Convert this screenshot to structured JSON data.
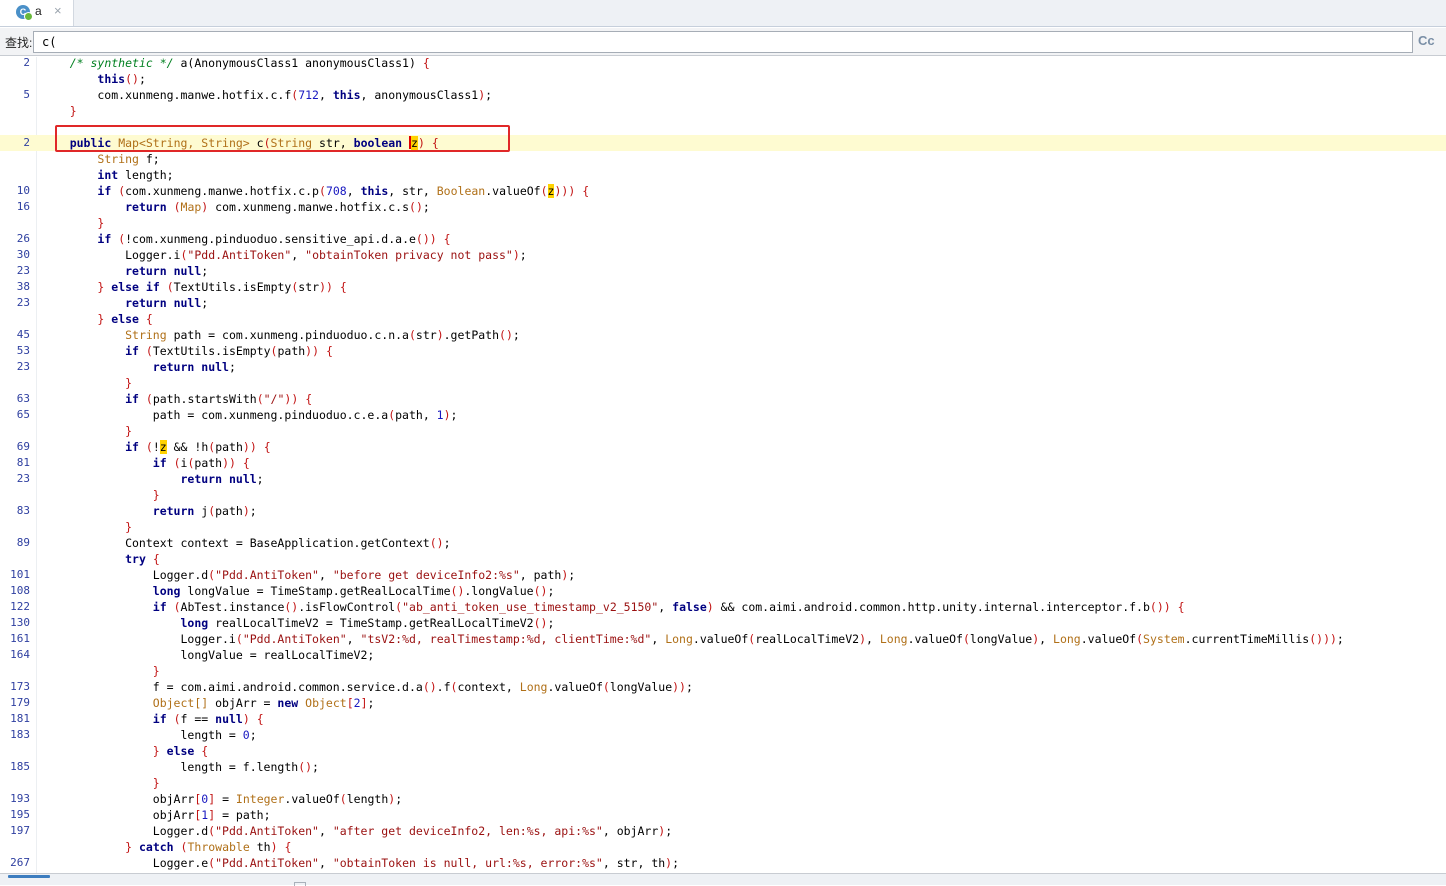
{
  "tab": {
    "label": "a",
    "icon": "class-c-icon",
    "close": "×"
  },
  "find": {
    "label": "查找:",
    "value": "c(",
    "case_toggle": "Cc"
  },
  "lines": [
    {
      "n": "2",
      "html": "    <span class=\"c\">/* synthetic */</span> a(AnonymousClass1 anonymousClass1) <span class=\"p\">{</span>"
    },
    {
      "n": "",
      "html": "        <span class=\"k\">this</span><span class=\"p\">()</span>;"
    },
    {
      "n": "5",
      "html": "        com.xunmeng.manwe.hotfix.c.f<span class=\"p\">(</span><span class=\"n\">712</span>, <span class=\"k\">this</span>, anonymousClass1<span class=\"p\">)</span>;"
    },
    {
      "n": "",
      "html": "    <span class=\"p\">}</span>"
    },
    {
      "n": "",
      "html": ""
    },
    {
      "n": "2",
      "hl": true,
      "html": "    <span class=\"k\">public</span> <span class=\"t\">Map&lt;String, String&gt;</span> c<span class=\"p\">(</span><span class=\"t\">String</span> str, <span class=\"k\">boolean</span> <span class=\"caret\"></span><span class=\"m\">z</span><span class=\"p\">)</span> <span class=\"p\">{</span>"
    },
    {
      "n": "",
      "html": "        <span class=\"t\">String</span> f;"
    },
    {
      "n": "",
      "html": "        <span class=\"k\">int</span> length;"
    },
    {
      "n": "10",
      "html": "        <span class=\"k\">if</span> <span class=\"p\">(</span>com.xunmeng.manwe.hotfix.c.p<span class=\"p\">(</span><span class=\"n\">708</span>, <span class=\"k\">this</span>, str, <span class=\"t\">Boolean</span>.valueOf<span class=\"p\">(</span><span class=\"m\">z</span><span class=\"p\">)))</span> <span class=\"p\">{</span>"
    },
    {
      "n": "16",
      "html": "            <span class=\"k\">return</span> <span class=\"p\">(</span><span class=\"t\">Map</span><span class=\"p\">)</span> com.xunmeng.manwe.hotfix.c.s<span class=\"p\">()</span>;"
    },
    {
      "n": "",
      "html": "        <span class=\"p\">}</span>"
    },
    {
      "n": "26",
      "html": "        <span class=\"k\">if</span> <span class=\"p\">(</span>!com.xunmeng.pinduoduo.sensitive_api.d.a.e<span class=\"p\">())</span> <span class=\"p\">{</span>"
    },
    {
      "n": "30",
      "html": "            Logger.i<span class=\"p\">(</span><span class=\"s\">\"Pdd.AntiToken\"</span>, <span class=\"s\">\"obtainToken privacy not pass\"</span><span class=\"p\">)</span>;"
    },
    {
      "n": "23",
      "html": "            <span class=\"k\">return</span> <span class=\"k\">null</span>;"
    },
    {
      "n": "38",
      "html": "        <span class=\"p\">}</span> <span class=\"k\">else</span> <span class=\"k\">if</span> <span class=\"p\">(</span>TextUtils.isEmpty<span class=\"p\">(</span>str<span class=\"p\">))</span> <span class=\"p\">{</span>"
    },
    {
      "n": "23",
      "html": "            <span class=\"k\">return</span> <span class=\"k\">null</span>;"
    },
    {
      "n": "",
      "html": "        <span class=\"p\">}</span> <span class=\"k\">else</span> <span class=\"p\">{</span>"
    },
    {
      "n": "45",
      "html": "            <span class=\"t\">String</span> path = com.xunmeng.pinduoduo.c.n.a<span class=\"p\">(</span>str<span class=\"p\">)</span>.getPath<span class=\"p\">()</span>;"
    },
    {
      "n": "53",
      "html": "            <span class=\"k\">if</span> <span class=\"p\">(</span>TextUtils.isEmpty<span class=\"p\">(</span>path<span class=\"p\">))</span> <span class=\"p\">{</span>"
    },
    {
      "n": "23",
      "html": "                <span class=\"k\">return</span> <span class=\"k\">null</span>;"
    },
    {
      "n": "",
      "html": "            <span class=\"p\">}</span>"
    },
    {
      "n": "63",
      "html": "            <span class=\"k\">if</span> <span class=\"p\">(</span>path.startsWith<span class=\"p\">(</span><span class=\"s\">\"/\"</span><span class=\"p\">))</span> <span class=\"p\">{</span>"
    },
    {
      "n": "65",
      "html": "                path = com.xunmeng.pinduoduo.c.e.a<span class=\"p\">(</span>path, <span class=\"n\">1</span><span class=\"p\">)</span>;"
    },
    {
      "n": "",
      "html": "            <span class=\"p\">}</span>"
    },
    {
      "n": "69",
      "html": "            <span class=\"k\">if</span> <span class=\"p\">(</span>!<span class=\"m\">z</span> &amp;&amp; !h<span class=\"p\">(</span>path<span class=\"p\">))</span> <span class=\"p\">{</span>"
    },
    {
      "n": "81",
      "html": "                <span class=\"k\">if</span> <span class=\"p\">(</span>i<span class=\"p\">(</span>path<span class=\"p\">))</span> <span class=\"p\">{</span>"
    },
    {
      "n": "23",
      "html": "                    <span class=\"k\">return</span> <span class=\"k\">null</span>;"
    },
    {
      "n": "",
      "html": "                <span class=\"p\">}</span>"
    },
    {
      "n": "83",
      "html": "                <span class=\"k\">return</span> j<span class=\"p\">(</span>path<span class=\"p\">)</span>;"
    },
    {
      "n": "",
      "html": "            <span class=\"p\">}</span>"
    },
    {
      "n": "89",
      "html": "            Context context = BaseApplication.getContext<span class=\"p\">()</span>;"
    },
    {
      "n": "",
      "html": "            <span class=\"k\">try</span> <span class=\"p\">{</span>"
    },
    {
      "n": "101",
      "html": "                Logger.d<span class=\"p\">(</span><span class=\"s\">\"Pdd.AntiToken\"</span>, <span class=\"s\">\"before get deviceInfo2:%s\"</span>, path<span class=\"p\">)</span>;"
    },
    {
      "n": "108",
      "html": "                <span class=\"k\">long</span> longValue = TimeStamp.getRealLocalTime<span class=\"p\">()</span>.longValue<span class=\"p\">()</span>;"
    },
    {
      "n": "122",
      "html": "                <span class=\"k\">if</span> <span class=\"p\">(</span>AbTest.instance<span class=\"p\">()</span>.isFlowControl<span class=\"p\">(</span><span class=\"s\">\"ab_anti_token_use_timestamp_v2_5150\"</span>, <span class=\"k\">false</span><span class=\"p\">)</span> &amp;&amp; com.aimi.android.common.http.unity.internal.interceptor.f.b<span class=\"p\">())</span> <span class=\"p\">{</span>"
    },
    {
      "n": "130",
      "html": "                    <span class=\"k\">long</span> realLocalTimeV2 = TimeStamp.getRealLocalTimeV2<span class=\"p\">()</span>;"
    },
    {
      "n": "161",
      "html": "                    Logger.i<span class=\"p\">(</span><span class=\"s\">\"Pdd.AntiToken\"</span>, <span class=\"s\">\"tsV2:%d, realTimestamp:%d, clientTime:%d\"</span>, <span class=\"t\">Long</span>.valueOf<span class=\"p\">(</span>realLocalTimeV2<span class=\"p\">)</span>, <span class=\"t\">Long</span>.valueOf<span class=\"p\">(</span>longValue<span class=\"p\">)</span>, <span class=\"t\">Long</span>.valueOf<span class=\"p\">(</span><span class=\"t\">System</span>.currentTimeMillis<span class=\"p\">()))</span>;"
    },
    {
      "n": "164",
      "html": "                    longValue = realLocalTimeV2;"
    },
    {
      "n": "",
      "html": "                <span class=\"p\">}</span>"
    },
    {
      "n": "173",
      "html": "                f = com.aimi.android.common.service.d.a<span class=\"p\">()</span>.f<span class=\"p\">(</span>context, <span class=\"t\">Long</span>.valueOf<span class=\"p\">(</span>longValue<span class=\"p\">))</span>;"
    },
    {
      "n": "179",
      "html": "                <span class=\"t\">Object[]</span> objArr = <span class=\"k\">new</span> <span class=\"t\">Object</span><span class=\"p\">[</span><span class=\"n\">2</span><span class=\"p\">]</span>;"
    },
    {
      "n": "181",
      "html": "                <span class=\"k\">if</span> <span class=\"p\">(</span>f == <span class=\"k\">null</span><span class=\"p\">)</span> <span class=\"p\">{</span>"
    },
    {
      "n": "183",
      "html": "                    length = <span class=\"n\">0</span>;"
    },
    {
      "n": "",
      "html": "                <span class=\"p\">}</span> <span class=\"k\">else</span> <span class=\"p\">{</span>"
    },
    {
      "n": "185",
      "html": "                    length = f.length<span class=\"p\">()</span>;"
    },
    {
      "n": "",
      "html": "                <span class=\"p\">}</span>"
    },
    {
      "n": "193",
      "html": "                objArr<span class=\"p\">[</span><span class=\"n\">0</span><span class=\"p\">]</span> = <span class=\"t\">Integer</span>.valueOf<span class=\"p\">(</span>length<span class=\"p\">)</span>;"
    },
    {
      "n": "195",
      "html": "                objArr<span class=\"p\">[</span><span class=\"n\">1</span><span class=\"p\">]</span> = path;"
    },
    {
      "n": "197",
      "html": "                Logger.d<span class=\"p\">(</span><span class=\"s\">\"Pdd.AntiToken\"</span>, <span class=\"s\">\"after get deviceInfo2, len:%s, api:%s\"</span>, objArr<span class=\"p\">)</span>;"
    },
    {
      "n": "",
      "html": "            <span class=\"p\">}</span> <span class=\"k\">catch</span> <span class=\"p\">(</span><span class=\"t\">Throwable</span> th<span class=\"p\">)</span> <span class=\"p\">{</span>"
    },
    {
      "n": "267",
      "html": "                Logger.e<span class=\"p\">(</span><span class=\"s\">\"Pdd.AntiToken\"</span>, <span class=\"s\">\"obtainToken is null, url:%s, error:%s\"</span>, str, th<span class=\"p\">)</span>;"
    }
  ]
}
